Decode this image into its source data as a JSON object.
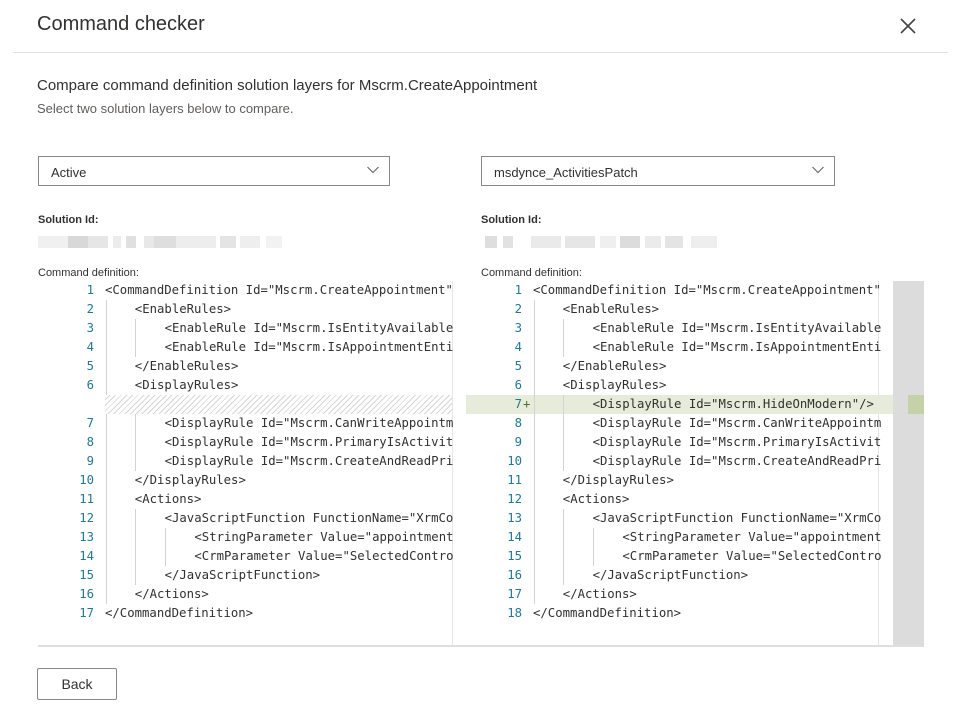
{
  "dialog": {
    "title": "Command checker",
    "close_icon": "close-icon",
    "subtitle": "Compare command definition solution layers for Mscrm.CreateAppointment",
    "hint": "Select two solution layers below to compare."
  },
  "left": {
    "select_value": "Active",
    "solution_id_label": "Solution Id:",
    "solution_id_value": "(redacted)",
    "command_definition_label": "Command definition:"
  },
  "right": {
    "select_value": "msdynce_ActivitiesPatch",
    "solution_id_label": "Solution Id:",
    "solution_id_value": "(redacted)",
    "command_definition_label": "Command definition:"
  },
  "diff": {
    "left_lines": [
      {
        "n": "1",
        "indent": 0,
        "text": "<CommandDefinition Id=\"Mscrm.CreateAppointment\""
      },
      {
        "n": "2",
        "indent": 1,
        "text": "<EnableRules>"
      },
      {
        "n": "3",
        "indent": 2,
        "text": "<EnableRule Id=\"Mscrm.IsEntityAvailable"
      },
      {
        "n": "4",
        "indent": 2,
        "text": "<EnableRule Id=\"Mscrm.IsAppointmentEnti"
      },
      {
        "n": "5",
        "indent": 1,
        "text": "</EnableRules>"
      },
      {
        "n": "6",
        "indent": 1,
        "text": "<DisplayRules>"
      },
      {
        "n": "",
        "indent": 0,
        "text": "",
        "type": "placeholder"
      },
      {
        "n": "7",
        "indent": 2,
        "text": "<DisplayRule Id=\"Mscrm.CanWriteAppointm"
      },
      {
        "n": "8",
        "indent": 2,
        "text": "<DisplayRule Id=\"Mscrm.PrimaryIsActivit"
      },
      {
        "n": "9",
        "indent": 2,
        "text": "<DisplayRule Id=\"Mscrm.CreateAndReadPri"
      },
      {
        "n": "10",
        "indent": 1,
        "text": "</DisplayRules>"
      },
      {
        "n": "11",
        "indent": 1,
        "text": "<Actions>"
      },
      {
        "n": "12",
        "indent": 2,
        "text": "<JavaScriptFunction FunctionName=\"XrmCo"
      },
      {
        "n": "13",
        "indent": 3,
        "text": "<StringParameter Value=\"appointment"
      },
      {
        "n": "14",
        "indent": 3,
        "text": "<CrmParameter Value=\"SelectedContro"
      },
      {
        "n": "15",
        "indent": 2,
        "text": "</JavaScriptFunction>"
      },
      {
        "n": "16",
        "indent": 1,
        "text": "</Actions>"
      },
      {
        "n": "17",
        "indent": 0,
        "text": "</CommandDefinition>"
      }
    ],
    "right_lines": [
      {
        "n": "1",
        "indent": 0,
        "text": "<CommandDefinition Id=\"Mscrm.CreateAppointment\""
      },
      {
        "n": "2",
        "indent": 1,
        "text": "<EnableRules>"
      },
      {
        "n": "3",
        "indent": 2,
        "text": "<EnableRule Id=\"Mscrm.IsEntityAvailable"
      },
      {
        "n": "4",
        "indent": 2,
        "text": "<EnableRule Id=\"Mscrm.IsAppointmentEnti"
      },
      {
        "n": "5",
        "indent": 1,
        "text": "</EnableRules>"
      },
      {
        "n": "6",
        "indent": 1,
        "text": "<DisplayRules>"
      },
      {
        "n": "7",
        "indent": 2,
        "text": "<DisplayRule Id=\"Mscrm.HideOnModern\"/>",
        "type": "added",
        "marker": "+"
      },
      {
        "n": "8",
        "indent": 2,
        "text": "<DisplayRule Id=\"Mscrm.CanWriteAppointm"
      },
      {
        "n": "9",
        "indent": 2,
        "text": "<DisplayRule Id=\"Mscrm.PrimaryIsActivit"
      },
      {
        "n": "10",
        "indent": 2,
        "text": "<DisplayRule Id=\"Mscrm.CreateAndReadPri"
      },
      {
        "n": "11",
        "indent": 1,
        "text": "</DisplayRules>"
      },
      {
        "n": "12",
        "indent": 1,
        "text": "<Actions>"
      },
      {
        "n": "13",
        "indent": 2,
        "text": "<JavaScriptFunction FunctionName=\"XrmCo"
      },
      {
        "n": "14",
        "indent": 3,
        "text": "<StringParameter Value=\"appointment"
      },
      {
        "n": "15",
        "indent": 3,
        "text": "<CrmParameter Value=\"SelectedContro"
      },
      {
        "n": "16",
        "indent": 2,
        "text": "</JavaScriptFunction>"
      },
      {
        "n": "17",
        "indent": 1,
        "text": "</Actions>"
      },
      {
        "n": "18",
        "indent": 0,
        "text": "</CommandDefinition>"
      }
    ]
  },
  "colors": {
    "added_bg": "#e6ecd9",
    "added_overview": "#c5d1a7",
    "line_number": "#237893"
  },
  "footer": {
    "back_label": "Back"
  }
}
